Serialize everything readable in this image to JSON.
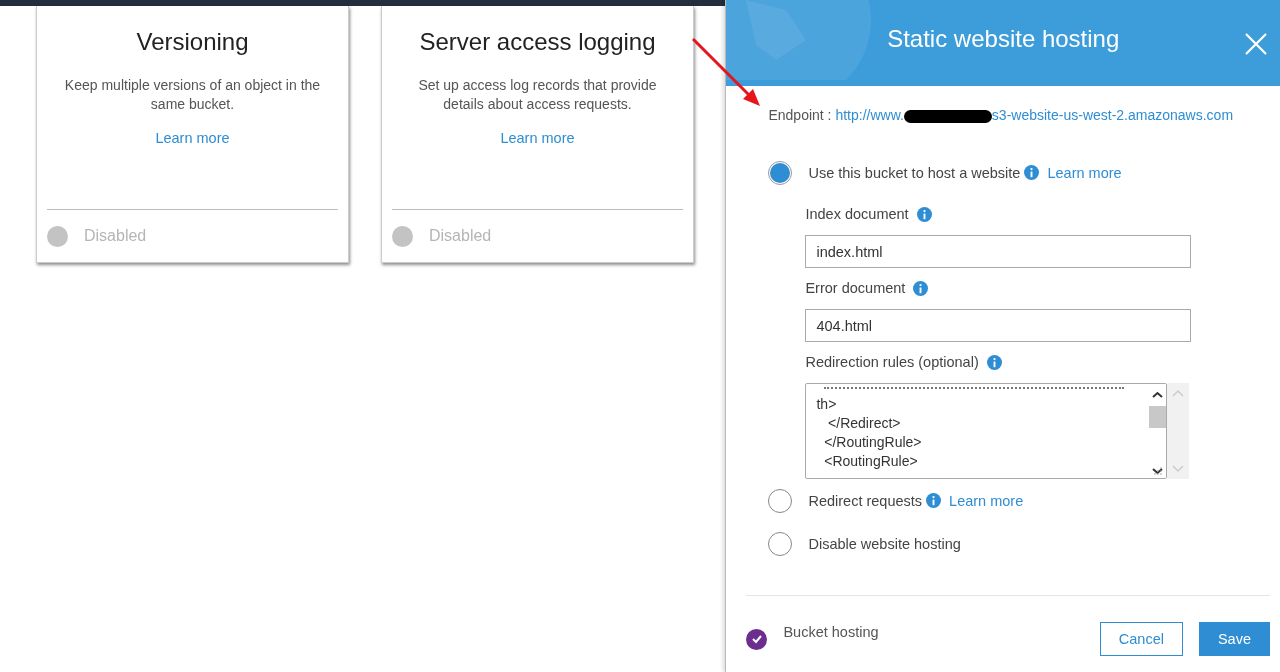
{
  "cards": [
    {
      "title": "Versioning",
      "description": "Keep multiple versions of an object in the same bucket.",
      "link": "Learn more",
      "status": "Disabled",
      "enabled": false
    },
    {
      "title": "Server access logging",
      "description": "Set up access log records that provide details about access requests.",
      "link": "Learn more",
      "status": "Disabled",
      "enabled": false
    }
  ],
  "panel": {
    "title": "Static website hosting",
    "endpoint": {
      "label": "Endpoint :",
      "prefix": "http://www.",
      "redacted": true,
      "suffix": "s3-website-us-west-2.amazonaws.com"
    },
    "options": [
      {
        "label": "Use this bucket to host a website",
        "selected": true,
        "info": true,
        "link": "Learn more"
      },
      {
        "label": "Redirect requests",
        "selected": false,
        "info": true,
        "link": "Learn more"
      },
      {
        "label": "Disable website hosting",
        "selected": false,
        "info": false
      }
    ],
    "index_document": {
      "label": "Index document",
      "value": "index.html"
    },
    "error_document": {
      "label": "Error document",
      "value": "404.html"
    },
    "redirection_rules": {
      "label": "Redirection rules (optional)",
      "lines": [
        "th>",
        "   </Redirect>",
        "  </RoutingRule>",
        "  <RoutingRule>"
      ]
    },
    "footer": {
      "status": "Bucket hosting",
      "checked": true,
      "buttons": [
        {
          "label": "Cancel",
          "kind": "secondary"
        },
        {
          "label": "Save",
          "kind": "primary"
        }
      ]
    }
  }
}
